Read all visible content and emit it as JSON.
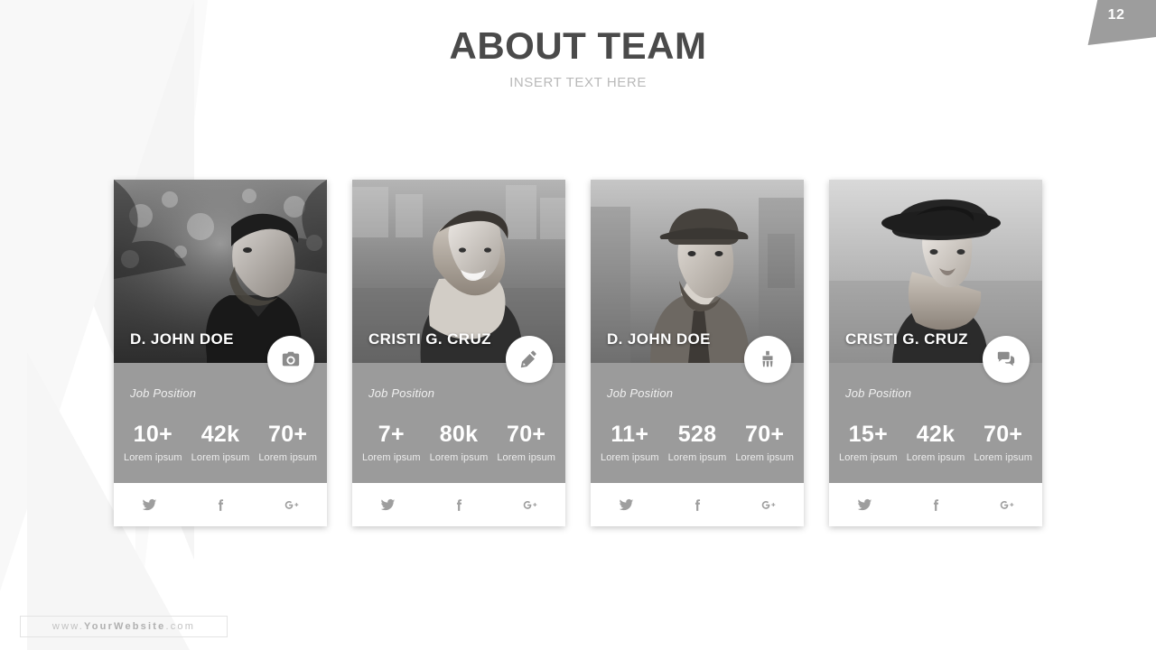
{
  "header": {
    "title": "ABOUT TEAM",
    "subtitle": "INSERT TEXT HERE"
  },
  "page_number": "12",
  "footer": {
    "prefix": "www.",
    "brand": "YourWebsite",
    "suffix": ".com"
  },
  "colors": {
    "title": "#4a4a4a",
    "subtitle": "#b9b9b9",
    "info_panel": "#9b9b9b",
    "ribbon": "#9d9d9d",
    "social_icon": "#9e9e9e",
    "card_background": "#ffffff"
  },
  "social": [
    {
      "name": "twitter",
      "icon": "twitter-icon"
    },
    {
      "name": "facebook",
      "icon": "facebook-icon"
    },
    {
      "name": "googleplus",
      "icon": "googleplus-icon"
    }
  ],
  "cards": [
    {
      "name": "D. JOHN DOE",
      "job": "Job Position",
      "badge_icon": "camera-icon",
      "photo_alt": "bearded man in black shirt, grayscale portrait",
      "stats": [
        {
          "value": "10+",
          "label": "Lorem ipsum"
        },
        {
          "value": "42k",
          "label": "Lorem ipsum"
        },
        {
          "value": "70+",
          "label": "Lorem ipsum"
        }
      ]
    },
    {
      "name": "CRISTI G. CRUZ",
      "job": "Job Position",
      "badge_icon": "pencil-icon",
      "photo_alt": "smiling blonde woman with beanie, grayscale portrait",
      "stats": [
        {
          "value": "7+",
          "label": "Lorem ipsum"
        },
        {
          "value": "80k",
          "label": "Lorem ipsum"
        },
        {
          "value": "70+",
          "label": "Lorem ipsum"
        }
      ]
    },
    {
      "name": "D. JOHN DOE",
      "job": "Job Position",
      "badge_icon": "brush-icon",
      "photo_alt": "man in flat cap and vest, grayscale portrait",
      "stats": [
        {
          "value": "11+",
          "label": "Lorem ipsum"
        },
        {
          "value": "528",
          "label": "Lorem ipsum"
        },
        {
          "value": "70+",
          "label": "Lorem ipsum"
        }
      ]
    },
    {
      "name": "CRISTI G. CRUZ",
      "job": "Job Position",
      "badge_icon": "chat-icon",
      "photo_alt": "woman in wide brim hat, grayscale portrait",
      "stats": [
        {
          "value": "15+",
          "label": "Lorem ipsum"
        },
        {
          "value": "42k",
          "label": "Lorem ipsum"
        },
        {
          "value": "70+",
          "label": "Lorem ipsum"
        }
      ]
    }
  ]
}
